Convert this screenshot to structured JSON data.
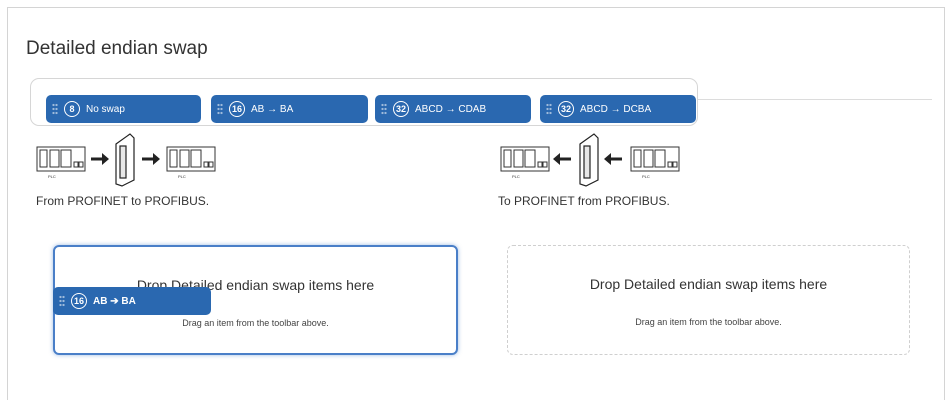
{
  "section": {
    "title": "Detailed endian swap"
  },
  "toolbar": {
    "items": [
      {
        "badge": "8",
        "label": "No swap"
      },
      {
        "badge": "16",
        "label": "AB → BA"
      },
      {
        "badge": "32",
        "label": "ABCD → CDAB"
      },
      {
        "badge": "32",
        "label": "ABCD → DCBA"
      }
    ]
  },
  "diagrams": {
    "left": {
      "plc_label": "PLC",
      "caption": "From PROFINET to PROFIBUS."
    },
    "right": {
      "plc_label": "PLC",
      "caption": "To PROFINET from PROFIBUS."
    }
  },
  "dropzones": {
    "profinet_to_profibus": {
      "title": "Drop Detailed endian swap items here",
      "hint": "Drag an item from the toolbar above."
    },
    "profibus_to_profinet": {
      "title": "Drop Detailed endian swap items here",
      "hint": "Drag an item from the toolbar above."
    }
  },
  "dragging_item": {
    "badge": "16",
    "label": "AB ➔ BA"
  },
  "colors": {
    "chip_blue": "#2a68b0",
    "active_border": "#4a7fc8"
  }
}
